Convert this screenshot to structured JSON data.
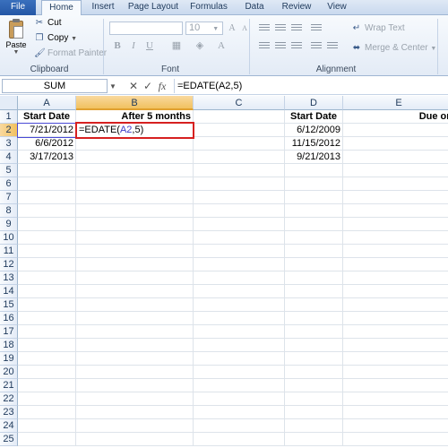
{
  "tabs": [
    "File",
    "Home",
    "Insert",
    "Page Layout",
    "Formulas",
    "Data",
    "Review",
    "View"
  ],
  "clipboard": {
    "paste": "Paste",
    "cut": "Cut",
    "copy": "Copy",
    "format_painter": "Format Painter",
    "label": "Clipboard"
  },
  "font": {
    "name": "",
    "size": "10",
    "bold": "B",
    "italic": "I",
    "underline": "U",
    "label": "Font"
  },
  "alignment": {
    "wrap_text": "Wrap Text",
    "merge_center": "Merge & Center",
    "label": "Alignment"
  },
  "formula_bar": {
    "name_box": "SUM",
    "cancel": "✕",
    "enter": "✓",
    "fx": "fx",
    "formula": "=EDATE(A2,5)"
  },
  "columns": [
    "A",
    "B",
    "C",
    "D",
    "E"
  ],
  "rows": [
    "1",
    "2",
    "3",
    "4",
    "5",
    "6",
    "7",
    "8",
    "9",
    "10",
    "11",
    "12",
    "13",
    "14",
    "15",
    "16",
    "17",
    "18",
    "19",
    "20",
    "21",
    "22",
    "23",
    "24",
    "25"
  ],
  "cells": {
    "A1": "Start Date",
    "B1": "After 5 months",
    "D1": "Start Date",
    "E1": "Due on",
    "A2": "7/21/2012",
    "A3": "6/6/2012",
    "A4": "3/17/2013",
    "D2": "6/12/2009",
    "D3": "11/15/2012",
    "D4": "9/21/2013",
    "B2_prefix": "=EDATE(",
    "B2_ref": "A2",
    "B2_suffix": ",5)"
  },
  "accent": "#d62020",
  "reference_color": "#3c3cc8"
}
